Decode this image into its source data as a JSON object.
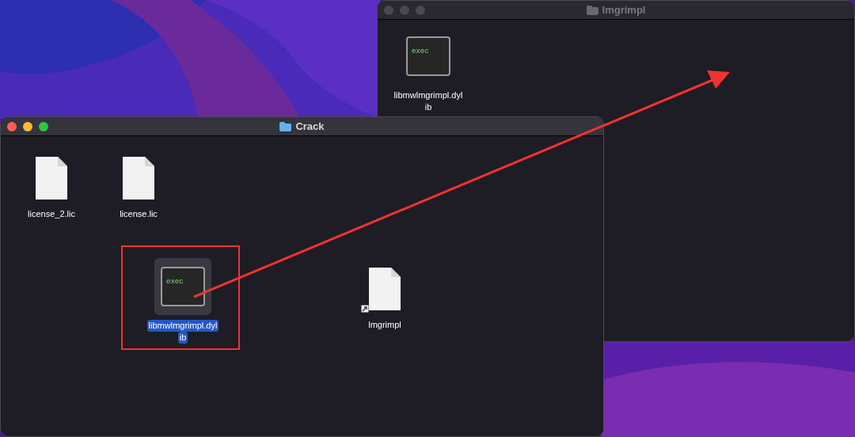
{
  "windows": [
    {
      "title": "lmgrimpl",
      "active": false,
      "items": [
        {
          "kind": "exec",
          "icon_text": "exec",
          "name_lines": [
            "libmwlmgrimpl.dyl",
            "ib"
          ],
          "selected": false,
          "alias": false
        }
      ]
    },
    {
      "title": "Crack",
      "active": true,
      "items": [
        {
          "kind": "document",
          "name_lines": [
            "license_2.lic"
          ],
          "selected": false,
          "alias": false
        },
        {
          "kind": "document",
          "name_lines": [
            "license.lic"
          ],
          "selected": false,
          "alias": false
        },
        {
          "kind": "exec",
          "icon_text": "exec",
          "name_lines": [
            "libmwlmgrimpl.dyl",
            "ib"
          ],
          "selected": true,
          "alias": false
        },
        {
          "kind": "document",
          "name_lines": [
            "lmgrimpl"
          ],
          "selected": false,
          "alias": true
        }
      ]
    }
  ]
}
